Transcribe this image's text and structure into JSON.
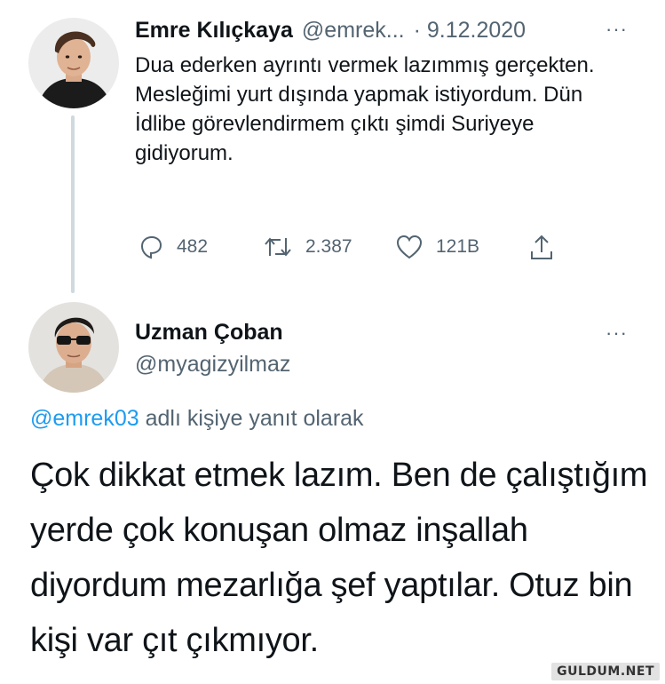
{
  "tweet1": {
    "author_name": "Emre Kılıçkaya",
    "author_handle": "@emrek...",
    "date": "· 9.12.2020",
    "more": "···",
    "text": "Dua ederken ayrıntı vermek lazımmış gerçekten. Mesleğimi yurt dışında yapmak istiyordum. Dün İdlibe görevlendirmem çıktı şimdi Suriyeye gidiyorum.",
    "actions": {
      "replies": "482",
      "retweets": "2.387",
      "likes": "121B"
    }
  },
  "tweet2": {
    "author_name": "Uzman Çoban",
    "author_handle": "@myagizyilmaz",
    "more": "···",
    "reply_mention": "@emrek03",
    "reply_suffix": " adlı kişiye yanıt olarak",
    "text": "Çok dikkat etmek lazım. Ben de çalıştığım yerde çok konuşan olmaz inşallah diyordum mezarlığa şef yaptılar. Otuz bin kişi var çıt çıkmıyor."
  },
  "watermark": "GULDUM.NET",
  "icons": [
    "reply-icon",
    "retweet-icon",
    "like-icon",
    "share-icon",
    "more-icon"
  ],
  "colors": {
    "link": "#1d9bf0",
    "secondary": "#536471",
    "text": "#0f1419"
  }
}
